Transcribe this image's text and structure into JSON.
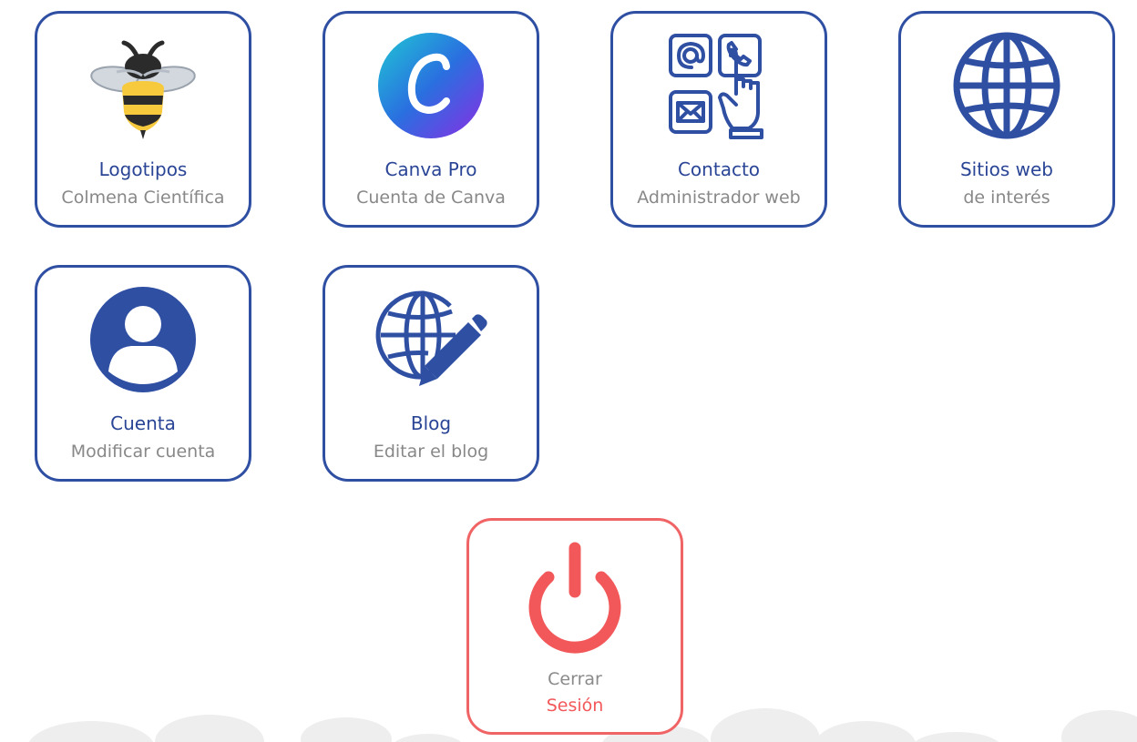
{
  "accent_color": "#2f4fa3",
  "logout_color": "#f06466",
  "tiles": [
    {
      "title": "Logotipos",
      "subtitle": "Colmena Científica",
      "icon": "bee-icon"
    },
    {
      "title": "Canva Pro",
      "subtitle": "Cuenta de Canva",
      "icon": "canva-logo-icon"
    },
    {
      "title": "Contacto",
      "subtitle": "Administrador web",
      "icon": "contact-icon"
    },
    {
      "title": "Sitios web",
      "subtitle": "de interés",
      "icon": "globe-icon"
    },
    {
      "title": "Cuenta",
      "subtitle": "Modificar cuenta",
      "icon": "user-icon"
    },
    {
      "title": "Blog",
      "subtitle": "Editar el blog",
      "icon": "globe-pencil-icon"
    }
  ],
  "logout": {
    "title": "Cerrar",
    "subtitle": "Sesión",
    "icon": "power-icon"
  }
}
